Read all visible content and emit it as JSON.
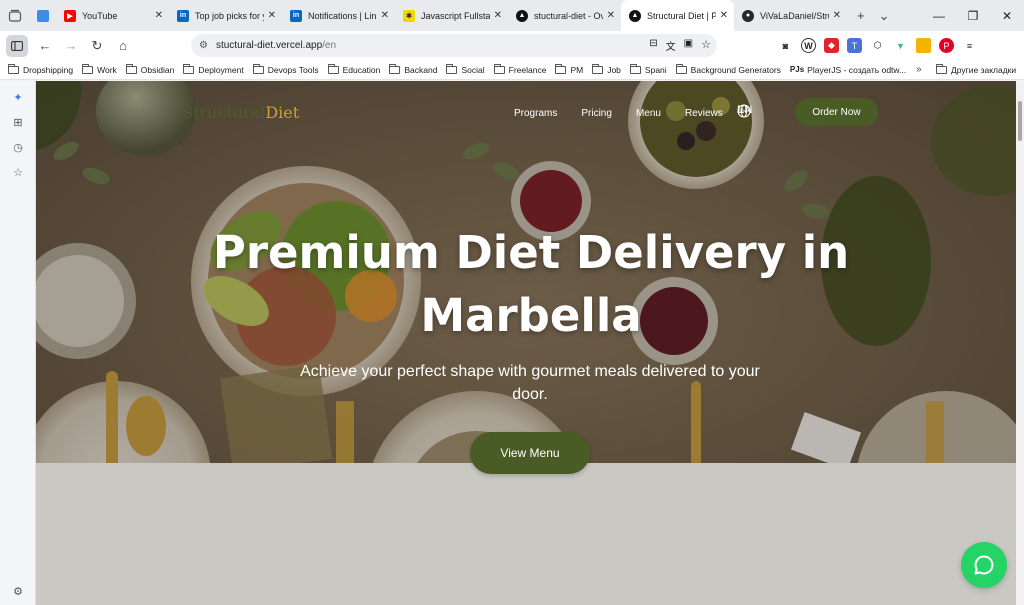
{
  "browser": {
    "tabs": [
      {
        "title": "YouTube",
        "favicon_color": "#ff0000",
        "active": false
      },
      {
        "title": "Top job picks for y",
        "favicon_color": "#0a66c2",
        "active": false
      },
      {
        "title": "Notifications | Link",
        "favicon_color": "#0a66c2",
        "active": false
      },
      {
        "title": "Javascript Fullstack",
        "favicon_color": "#f1d900",
        "active": false
      },
      {
        "title": "stuctural-diet - Ove",
        "favicon_color": "#111111",
        "active": false
      },
      {
        "title": "Structural Diet | Pr",
        "favicon_color": "#111111",
        "active": true
      },
      {
        "title": "ViVaLaDaniel/Struct",
        "favicon_color": "#24292f",
        "active": false
      }
    ],
    "url_host": "stuctural-diet.vercel.app",
    "url_path": "/en",
    "bookmarks": [
      "Dropshipping",
      "Work",
      "Obsidian",
      "Deployment",
      "Devops Tools",
      "Education",
      "Backand",
      "Social",
      "Freelance",
      "PM",
      "Job",
      "Spani",
      "Background Generators",
      "PlayerJS - создать odtw..."
    ],
    "other_bookmarks": "Другие закладки"
  },
  "site": {
    "brand_part1": "Structural",
    "brand_part2": "Diet",
    "brand_color1": "#4d5e2a",
    "brand_color2": "#c6a233",
    "nav": [
      "Programs",
      "Pricing",
      "Menu",
      "Reviews"
    ],
    "language": "EN",
    "order_button": "Order Now",
    "hero_title_line1": "Premium Diet Delivery in",
    "hero_title_line2": "Marbella",
    "hero_subtitle": "Achieve your perfect shape with gourmet meals delivered to your door.",
    "view_menu_button": "View Menu",
    "accent_color": "#4a5c26",
    "chat_color": "#25d366"
  }
}
